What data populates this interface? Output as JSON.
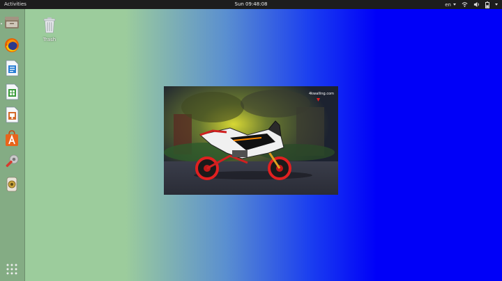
{
  "topbar": {
    "activities_label": "Activities",
    "clock": "Sun 09:48:08",
    "language": "en",
    "icons": [
      "network-icon",
      "volume-icon",
      "battery-icon",
      "power-menu-arrow"
    ]
  },
  "dock": {
    "apps": [
      {
        "name": "Files",
        "icon": "files-icon"
      },
      {
        "name": "Firefox Web Browser",
        "icon": "firefox-icon"
      },
      {
        "name": "LibreOffice Writer",
        "icon": "writer-icon"
      },
      {
        "name": "LibreOffice Calc",
        "icon": "calc-icon"
      },
      {
        "name": "LibreOffice Impress",
        "icon": "impress-icon"
      },
      {
        "name": "Ubuntu Software",
        "icon": "software-center-icon"
      },
      {
        "name": "Settings",
        "icon": "settings-icon"
      },
      {
        "name": "Software Updater",
        "icon": "updater-icon"
      }
    ],
    "show_apps_icon": "app-grid-icon"
  },
  "desktop": {
    "trash_label": "Trash",
    "wallpaper_colors": [
      "#9ccc9c",
      "#0000f8"
    ]
  },
  "image_viewer": {
    "watermark": "4kwalling.com",
    "subject": "motorcycle-photo"
  }
}
